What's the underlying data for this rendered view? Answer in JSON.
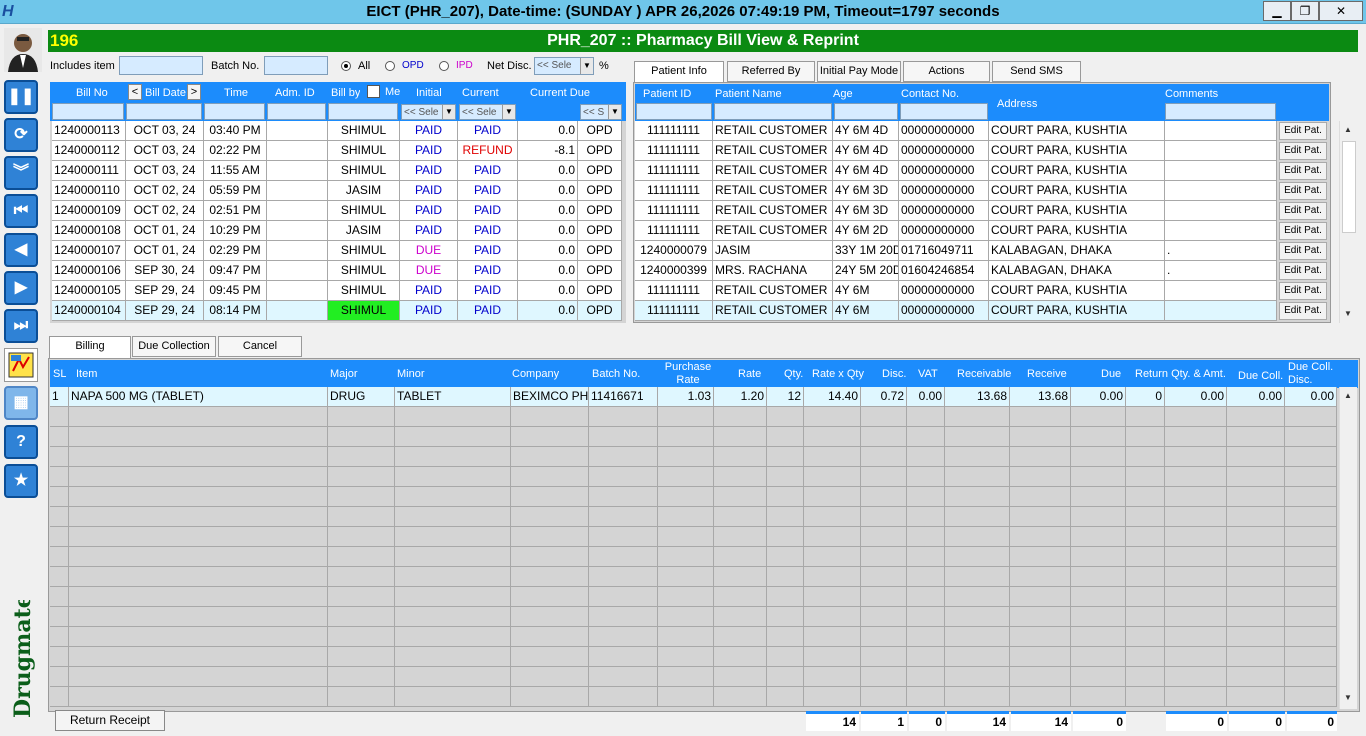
{
  "window": {
    "title": "EICT (PHR_207), Date-time: (SUNDAY   ) APR 26,2026 07:49:19 PM, Timeout=1797 seconds",
    "app_icon_char": "H",
    "controls": [
      "▁",
      "❐",
      "✕"
    ]
  },
  "header": {
    "counter": "196",
    "heading": "PHR_207 :: Pharmacy Bill View & Reprint"
  },
  "brand": "Drugmate",
  "filters": {
    "includes_item_label": "Includes item",
    "includes_item_value": "",
    "batch_label": "Batch No.",
    "batch_value": "",
    "radio_all": "All",
    "radio_opd": "OPD",
    "radio_ipd": "IPD",
    "net_disc_label": "Net Disc.",
    "net_disc_select": "<< Sele",
    "percent": "%"
  },
  "bills": {
    "headers": {
      "bill_no": "Bill No",
      "prev": "<",
      "bill_date": "Bill Date",
      "next": ">",
      "time": "Time",
      "adm_id": "Adm. ID",
      "bill_by": "Bill by",
      "me": "Me",
      "initial": "Initial",
      "current": "Current",
      "current_due": "Current Due"
    },
    "filter_selects": {
      "initial": "<< Sele",
      "current": "<< Sele",
      "type": "<< S"
    },
    "rows": [
      {
        "bill_no": "1240000113",
        "date": "OCT 03, 24",
        "time": "03:40 PM",
        "adm": "",
        "by": "SHIMUL",
        "initial": "PAID",
        "current": "PAID",
        "due": "0.0",
        "type": "OPD"
      },
      {
        "bill_no": "1240000112",
        "date": "OCT 03, 24",
        "time": "02:22 PM",
        "adm": "",
        "by": "SHIMUL",
        "initial": "PAID",
        "current": "REFUND",
        "due": "-8.1",
        "type": "OPD"
      },
      {
        "bill_no": "1240000111",
        "date": "OCT 03, 24",
        "time": "11:55 AM",
        "adm": "",
        "by": "SHIMUL",
        "initial": "PAID",
        "current": "PAID",
        "due": "0.0",
        "type": "OPD"
      },
      {
        "bill_no": "1240000110",
        "date": "OCT 02, 24",
        "time": "05:59 PM",
        "adm": "",
        "by": "JASIM",
        "initial": "PAID",
        "current": "PAID",
        "due": "0.0",
        "type": "OPD"
      },
      {
        "bill_no": "1240000109",
        "date": "OCT 02, 24",
        "time": "02:51 PM",
        "adm": "",
        "by": "SHIMUL",
        "initial": "PAID",
        "current": "PAID",
        "due": "0.0",
        "type": "OPD"
      },
      {
        "bill_no": "1240000108",
        "date": "OCT 01, 24",
        "time": "10:29 PM",
        "adm": "",
        "by": "JASIM",
        "initial": "PAID",
        "current": "PAID",
        "due": "0.0",
        "type": "OPD"
      },
      {
        "bill_no": "1240000107",
        "date": "OCT 01, 24",
        "time": "02:29 PM",
        "adm": "",
        "by": "SHIMUL",
        "initial": "DUE",
        "current": "PAID",
        "due": "0.0",
        "type": "OPD"
      },
      {
        "bill_no": "1240000106",
        "date": "SEP 30, 24",
        "time": "09:47 PM",
        "adm": "",
        "by": "SHIMUL",
        "initial": "DUE",
        "current": "PAID",
        "due": "0.0",
        "type": "OPD"
      },
      {
        "bill_no": "1240000105",
        "date": "SEP 29, 24",
        "time": "09:45 PM",
        "adm": "",
        "by": "SHIMUL",
        "initial": "PAID",
        "current": "PAID",
        "due": "0.0",
        "type": "OPD"
      },
      {
        "bill_no": "1240000104",
        "date": "SEP 29, 24",
        "time": "08:14 PM",
        "adm": "",
        "by": "SHIMUL",
        "initial": "PAID",
        "current": "PAID",
        "due": "0.0",
        "type": "OPD"
      }
    ]
  },
  "patient_tabs": [
    "Patient Info",
    "Referred By",
    "Initial Pay Mode",
    "Actions",
    "Send SMS"
  ],
  "patients": {
    "headers": {
      "id": "Patient ID",
      "name": "Patient Name",
      "age": "Age",
      "contact": "Contact No.",
      "address": "Address",
      "comments": "Comments"
    },
    "edit_label": "Edit Pat.",
    "rows": [
      {
        "id": "111111111",
        "name": "RETAIL CUSTOMER",
        "age": "4Y 6M 4D",
        "contact": "00000000000",
        "address": "COURT PARA, KUSHTIA",
        "comments": ""
      },
      {
        "id": "111111111",
        "name": "RETAIL CUSTOMER",
        "age": "4Y 6M 4D",
        "contact": "00000000000",
        "address": "COURT PARA, KUSHTIA",
        "comments": ""
      },
      {
        "id": "111111111",
        "name": "RETAIL CUSTOMER",
        "age": "4Y 6M 4D",
        "contact": "00000000000",
        "address": "COURT PARA, KUSHTIA",
        "comments": ""
      },
      {
        "id": "111111111",
        "name": "RETAIL CUSTOMER",
        "age": "4Y 6M 3D",
        "contact": "00000000000",
        "address": "COURT PARA, KUSHTIA",
        "comments": ""
      },
      {
        "id": "111111111",
        "name": "RETAIL CUSTOMER",
        "age": "4Y 6M 3D",
        "contact": "00000000000",
        "address": "COURT PARA, KUSHTIA",
        "comments": ""
      },
      {
        "id": "111111111",
        "name": "RETAIL CUSTOMER",
        "age": "4Y 6M 2D",
        "contact": "00000000000",
        "address": "COURT PARA, KUSHTIA",
        "comments": ""
      },
      {
        "id": "1240000079",
        "name": "JASIM",
        "age": "33Y 1M 20D",
        "contact": "01716049711",
        "address": "KALABAGAN, DHAKA",
        "comments": "."
      },
      {
        "id": "1240000399",
        "name": "MRS. RACHANA",
        "age": "24Y 5M 20D",
        "contact": "01604246854",
        "address": "KALABAGAN, DHAKA",
        "comments": "."
      },
      {
        "id": "111111111",
        "name": "RETAIL CUSTOMER",
        "age": "4Y 6M",
        "contact": "00000000000",
        "address": "COURT PARA, KUSHTIA",
        "comments": ""
      },
      {
        "id": "111111111",
        "name": "RETAIL CUSTOMER",
        "age": "4Y 6M",
        "contact": "00000000000",
        "address": "COURT PARA, KUSHTIA",
        "comments": ""
      }
    ]
  },
  "billing_tabs": [
    "Billing",
    "Due Collection",
    "Cancel"
  ],
  "items": {
    "headers": {
      "sl": "SL",
      "item": "Item",
      "major": "Major",
      "minor": "Minor",
      "company": "Company",
      "batch": "Batch No.",
      "prate": "Purchase Rate",
      "rate": "Rate",
      "qty": "Qty.",
      "rxq": "Rate x Qty",
      "disc": "Disc.",
      "vat": "VAT",
      "receivable": "Receivable",
      "receive": "Receive",
      "due": "Due",
      "ret": "Return Qty. & Amt.",
      "duecoll": "Due Coll.",
      "duecolldisc": "Due Coll. Disc."
    },
    "rows": [
      {
        "sl": "1",
        "item": "NAPA 500 MG (TABLET)",
        "major": "DRUG",
        "minor": "TABLET",
        "company": "BEXIMCO PHA",
        "batch": "11416671",
        "prate": "1.03",
        "rate": "1.20",
        "qty": "12",
        "rxq": "14.40",
        "disc": "0.72",
        "vat": "0.00",
        "receivable": "13.68",
        "receive": "13.68",
        "due": "0.00",
        "ret_qty": "0",
        "ret_amt": "0.00",
        "duecoll": "0.00",
        "duecolldisc": "0.00"
      }
    ]
  },
  "totals": {
    "rxq": "14",
    "disc": "1",
    "vat": "0",
    "receivable": "14",
    "receive": "14",
    "due": "0",
    "ret": "0",
    "duecoll": "0",
    "duecolldisc": "0"
  },
  "return_receipt_label": "Return Receipt",
  "colors": {
    "accent": "#1c8cfc",
    "header_green": "#0b8a12",
    "counter_yellow": "#ffff00",
    "paid": "#0000cc",
    "due": "#cc00cc",
    "refund": "#e00000",
    "highlight_green": "#22ee22"
  },
  "nav_icons": [
    "pause-icon",
    "refresh-icon",
    "chevron-double-down-icon",
    "first-icon",
    "previous-icon",
    "next-icon",
    "last-icon",
    "report-icon",
    "calculator-icon",
    "help-icon",
    "star-icon"
  ]
}
